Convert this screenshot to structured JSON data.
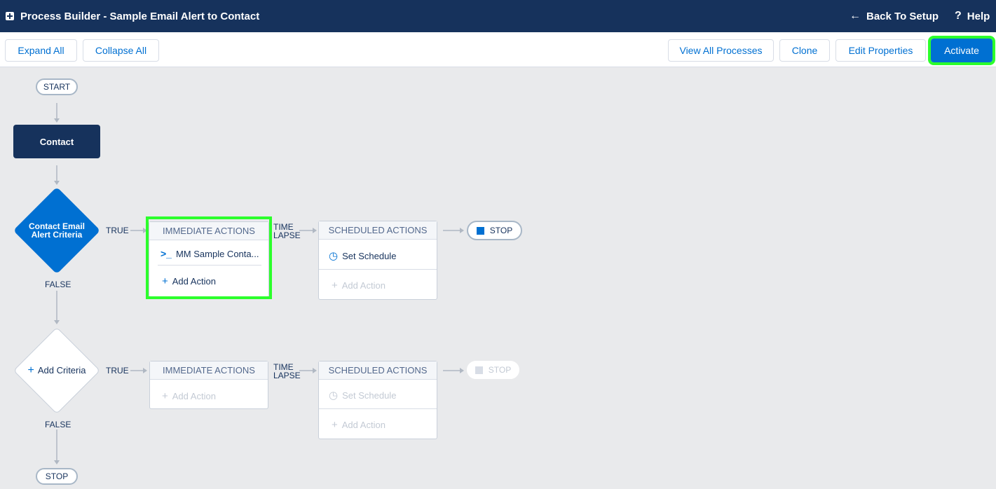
{
  "window": {
    "title": "Process Builder - Sample Email Alert to Contact"
  },
  "topnav": {
    "back_label": "Back To Setup",
    "help_label": "Help"
  },
  "toolbar": {
    "expand_all": "Expand All",
    "collapse_all": "Collapse All",
    "view_all_processes": "View All Processes",
    "clone": "Clone",
    "edit_properties": "Edit Properties",
    "activate": "Activate"
  },
  "flow": {
    "start_label": "START",
    "object_label": "Contact",
    "criteria1": {
      "label": "Contact Email Alert Criteria",
      "true_label": "TRUE",
      "false_label": "FALSE",
      "immediate_header": "IMMEDIATE ACTIONS",
      "immediate_action": "MM Sample Conta...",
      "add_action": "Add Action",
      "time_lapse_line1": "TIME",
      "time_lapse_line2": "LAPSE",
      "scheduled_header": "SCHEDULED ACTIONS",
      "set_schedule": "Set Schedule",
      "scheduled_add_action": "Add Action",
      "stop_label": "STOP"
    },
    "criteria2": {
      "label": "Add Criteria",
      "true_label": "TRUE",
      "false_label": "FALSE",
      "immediate_header": "IMMEDIATE ACTIONS",
      "add_action": "Add Action",
      "time_lapse_line1": "TIME",
      "time_lapse_line2": "LAPSE",
      "scheduled_header": "SCHEDULED ACTIONS",
      "set_schedule": "Set Schedule",
      "scheduled_add_action": "Add Action",
      "stop_label": "STOP"
    },
    "end_stop_label": "STOP"
  },
  "icons": {
    "app": "process-builder-icon",
    "back": "arrow-left-icon",
    "help": "question-icon",
    "action": "apex-action-icon",
    "add": "plus-icon",
    "schedule": "clock-icon",
    "stop": "stop-square-icon"
  },
  "colors": {
    "header_bg": "#16325c",
    "brand_blue": "#0070d2",
    "highlight_green": "#2cff2c",
    "canvas_bg": "#e9eaec"
  }
}
